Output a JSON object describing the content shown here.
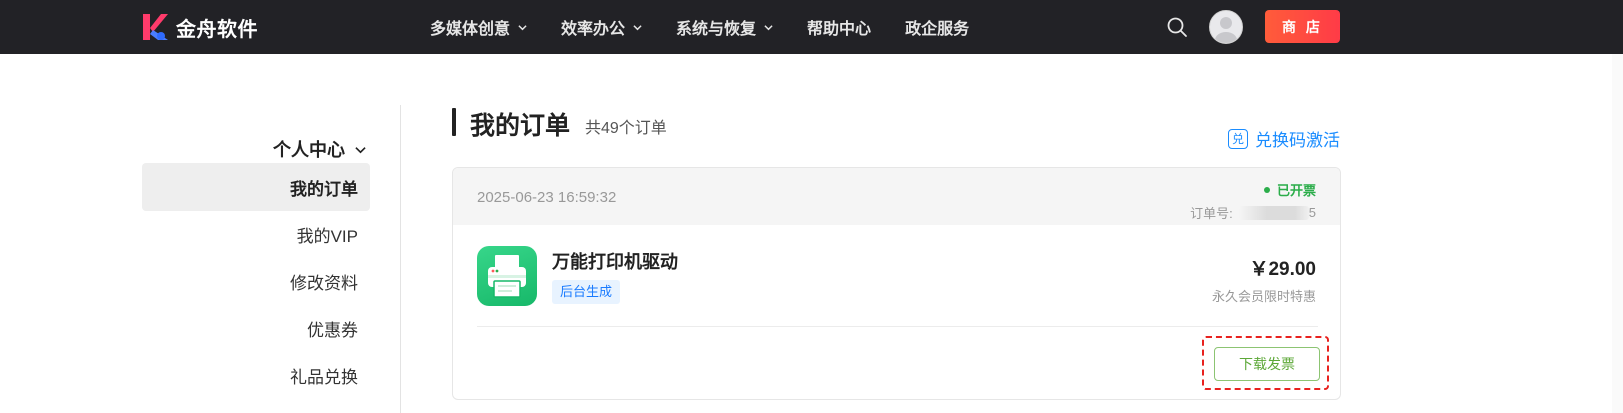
{
  "brand": {
    "name": "金舟软件"
  },
  "nav": {
    "items": [
      {
        "label": "多媒体创意",
        "has_dropdown": true
      },
      {
        "label": "效率办公",
        "has_dropdown": true
      },
      {
        "label": "系统与恢复",
        "has_dropdown": true
      },
      {
        "label": "帮助中心",
        "has_dropdown": false
      },
      {
        "label": "政企服务",
        "has_dropdown": false
      }
    ],
    "store_label": "商 店"
  },
  "sidebar": {
    "group_label": "个人中心",
    "items": [
      {
        "label": "我的订单",
        "active": true
      },
      {
        "label": "我的VIP",
        "active": false
      },
      {
        "label": "修改资料",
        "active": false
      },
      {
        "label": "优惠券",
        "active": false
      },
      {
        "label": "礼品兑换",
        "active": false
      }
    ]
  },
  "main": {
    "title": "我的订单",
    "count_text": "共49个订单",
    "redeem_label": "兑换码激活",
    "redeem_icon_char": "兑",
    "order": {
      "date": "2025-06-23 16:59:32",
      "status": "已开票",
      "order_no_label": "订单号:",
      "order_no_tail": "5",
      "product_name": "万能打印机驱动",
      "tag": "后台生成",
      "price": "￥29.00",
      "price_note": "永久会员限时特惠",
      "download_invoice_label": "下载发票"
    }
  },
  "colors": {
    "topbar": "#222226",
    "store_gradient_start": "#ff5c3a",
    "store_gradient_end": "#ff3b47",
    "accent_blue": "#1a8cff",
    "status_green": "#2bad4a",
    "highlight_red": "#e8211e"
  }
}
